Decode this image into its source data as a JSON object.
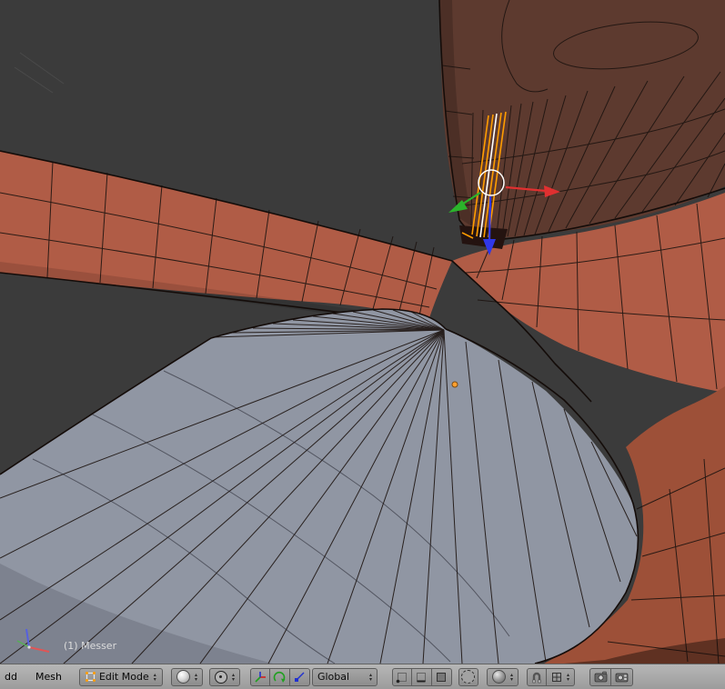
{
  "viewport": {
    "object_info": "(1) Messer"
  },
  "header": {
    "menus": [
      {
        "label": "dd"
      },
      {
        "label": "Mesh"
      }
    ],
    "mode_select": {
      "value": "Edit Mode"
    },
    "orientation_select": {
      "value": "Global"
    },
    "arrow_up": "▴",
    "arrow_down": "▾"
  },
  "colors": {
    "viewport_bg": "#3b3b3b",
    "mesh_red": "#b05c46",
    "mesh_red_dark": "#9d5038",
    "mesh_dark_brown": "#5d3a2f",
    "mesh_gray": "#9096a3",
    "wire": "#1d1410",
    "selected_edge": "#ff9d00",
    "active_edge": "#ffffff",
    "gizmo_red": "#e03030",
    "gizmo_green": "#2bb42b",
    "gizmo_blue": "#3038e8",
    "header_bg": "#a8a8a8",
    "origin_dot": "#ffa02f"
  }
}
